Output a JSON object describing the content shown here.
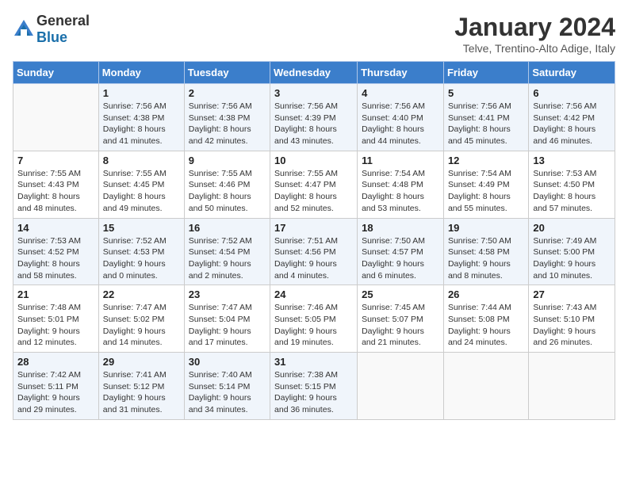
{
  "header": {
    "logo_general": "General",
    "logo_blue": "Blue",
    "title": "January 2024",
    "subtitle": "Telve, Trentino-Alto Adige, Italy"
  },
  "columns": [
    "Sunday",
    "Monday",
    "Tuesday",
    "Wednesday",
    "Thursday",
    "Friday",
    "Saturday"
  ],
  "weeks": [
    [
      {
        "day": "",
        "sunrise": "",
        "sunset": "",
        "daylight": ""
      },
      {
        "day": "1",
        "sunrise": "Sunrise: 7:56 AM",
        "sunset": "Sunset: 4:38 PM",
        "daylight": "Daylight: 8 hours and 41 minutes."
      },
      {
        "day": "2",
        "sunrise": "Sunrise: 7:56 AM",
        "sunset": "Sunset: 4:38 PM",
        "daylight": "Daylight: 8 hours and 42 minutes."
      },
      {
        "day": "3",
        "sunrise": "Sunrise: 7:56 AM",
        "sunset": "Sunset: 4:39 PM",
        "daylight": "Daylight: 8 hours and 43 minutes."
      },
      {
        "day": "4",
        "sunrise": "Sunrise: 7:56 AM",
        "sunset": "Sunset: 4:40 PM",
        "daylight": "Daylight: 8 hours and 44 minutes."
      },
      {
        "day": "5",
        "sunrise": "Sunrise: 7:56 AM",
        "sunset": "Sunset: 4:41 PM",
        "daylight": "Daylight: 8 hours and 45 minutes."
      },
      {
        "day": "6",
        "sunrise": "Sunrise: 7:56 AM",
        "sunset": "Sunset: 4:42 PM",
        "daylight": "Daylight: 8 hours and 46 minutes."
      }
    ],
    [
      {
        "day": "7",
        "sunrise": "Sunrise: 7:55 AM",
        "sunset": "Sunset: 4:43 PM",
        "daylight": "Daylight: 8 hours and 48 minutes."
      },
      {
        "day": "8",
        "sunrise": "Sunrise: 7:55 AM",
        "sunset": "Sunset: 4:45 PM",
        "daylight": "Daylight: 8 hours and 49 minutes."
      },
      {
        "day": "9",
        "sunrise": "Sunrise: 7:55 AM",
        "sunset": "Sunset: 4:46 PM",
        "daylight": "Daylight: 8 hours and 50 minutes."
      },
      {
        "day": "10",
        "sunrise": "Sunrise: 7:55 AM",
        "sunset": "Sunset: 4:47 PM",
        "daylight": "Daylight: 8 hours and 52 minutes."
      },
      {
        "day": "11",
        "sunrise": "Sunrise: 7:54 AM",
        "sunset": "Sunset: 4:48 PM",
        "daylight": "Daylight: 8 hours and 53 minutes."
      },
      {
        "day": "12",
        "sunrise": "Sunrise: 7:54 AM",
        "sunset": "Sunset: 4:49 PM",
        "daylight": "Daylight: 8 hours and 55 minutes."
      },
      {
        "day": "13",
        "sunrise": "Sunrise: 7:53 AM",
        "sunset": "Sunset: 4:50 PM",
        "daylight": "Daylight: 8 hours and 57 minutes."
      }
    ],
    [
      {
        "day": "14",
        "sunrise": "Sunrise: 7:53 AM",
        "sunset": "Sunset: 4:52 PM",
        "daylight": "Daylight: 8 hours and 58 minutes."
      },
      {
        "day": "15",
        "sunrise": "Sunrise: 7:52 AM",
        "sunset": "Sunset: 4:53 PM",
        "daylight": "Daylight: 9 hours and 0 minutes."
      },
      {
        "day": "16",
        "sunrise": "Sunrise: 7:52 AM",
        "sunset": "Sunset: 4:54 PM",
        "daylight": "Daylight: 9 hours and 2 minutes."
      },
      {
        "day": "17",
        "sunrise": "Sunrise: 7:51 AM",
        "sunset": "Sunset: 4:56 PM",
        "daylight": "Daylight: 9 hours and 4 minutes."
      },
      {
        "day": "18",
        "sunrise": "Sunrise: 7:50 AM",
        "sunset": "Sunset: 4:57 PM",
        "daylight": "Daylight: 9 hours and 6 minutes."
      },
      {
        "day": "19",
        "sunrise": "Sunrise: 7:50 AM",
        "sunset": "Sunset: 4:58 PM",
        "daylight": "Daylight: 9 hours and 8 minutes."
      },
      {
        "day": "20",
        "sunrise": "Sunrise: 7:49 AM",
        "sunset": "Sunset: 5:00 PM",
        "daylight": "Daylight: 9 hours and 10 minutes."
      }
    ],
    [
      {
        "day": "21",
        "sunrise": "Sunrise: 7:48 AM",
        "sunset": "Sunset: 5:01 PM",
        "daylight": "Daylight: 9 hours and 12 minutes."
      },
      {
        "day": "22",
        "sunrise": "Sunrise: 7:47 AM",
        "sunset": "Sunset: 5:02 PM",
        "daylight": "Daylight: 9 hours and 14 minutes."
      },
      {
        "day": "23",
        "sunrise": "Sunrise: 7:47 AM",
        "sunset": "Sunset: 5:04 PM",
        "daylight": "Daylight: 9 hours and 17 minutes."
      },
      {
        "day": "24",
        "sunrise": "Sunrise: 7:46 AM",
        "sunset": "Sunset: 5:05 PM",
        "daylight": "Daylight: 9 hours and 19 minutes."
      },
      {
        "day": "25",
        "sunrise": "Sunrise: 7:45 AM",
        "sunset": "Sunset: 5:07 PM",
        "daylight": "Daylight: 9 hours and 21 minutes."
      },
      {
        "day": "26",
        "sunrise": "Sunrise: 7:44 AM",
        "sunset": "Sunset: 5:08 PM",
        "daylight": "Daylight: 9 hours and 24 minutes."
      },
      {
        "day": "27",
        "sunrise": "Sunrise: 7:43 AM",
        "sunset": "Sunset: 5:10 PM",
        "daylight": "Daylight: 9 hours and 26 minutes."
      }
    ],
    [
      {
        "day": "28",
        "sunrise": "Sunrise: 7:42 AM",
        "sunset": "Sunset: 5:11 PM",
        "daylight": "Daylight: 9 hours and 29 minutes."
      },
      {
        "day": "29",
        "sunrise": "Sunrise: 7:41 AM",
        "sunset": "Sunset: 5:12 PM",
        "daylight": "Daylight: 9 hours and 31 minutes."
      },
      {
        "day": "30",
        "sunrise": "Sunrise: 7:40 AM",
        "sunset": "Sunset: 5:14 PM",
        "daylight": "Daylight: 9 hours and 34 minutes."
      },
      {
        "day": "31",
        "sunrise": "Sunrise: 7:38 AM",
        "sunset": "Sunset: 5:15 PM",
        "daylight": "Daylight: 9 hours and 36 minutes."
      },
      {
        "day": "",
        "sunrise": "",
        "sunset": "",
        "daylight": ""
      },
      {
        "day": "",
        "sunrise": "",
        "sunset": "",
        "daylight": ""
      },
      {
        "day": "",
        "sunrise": "",
        "sunset": "",
        "daylight": ""
      }
    ]
  ]
}
